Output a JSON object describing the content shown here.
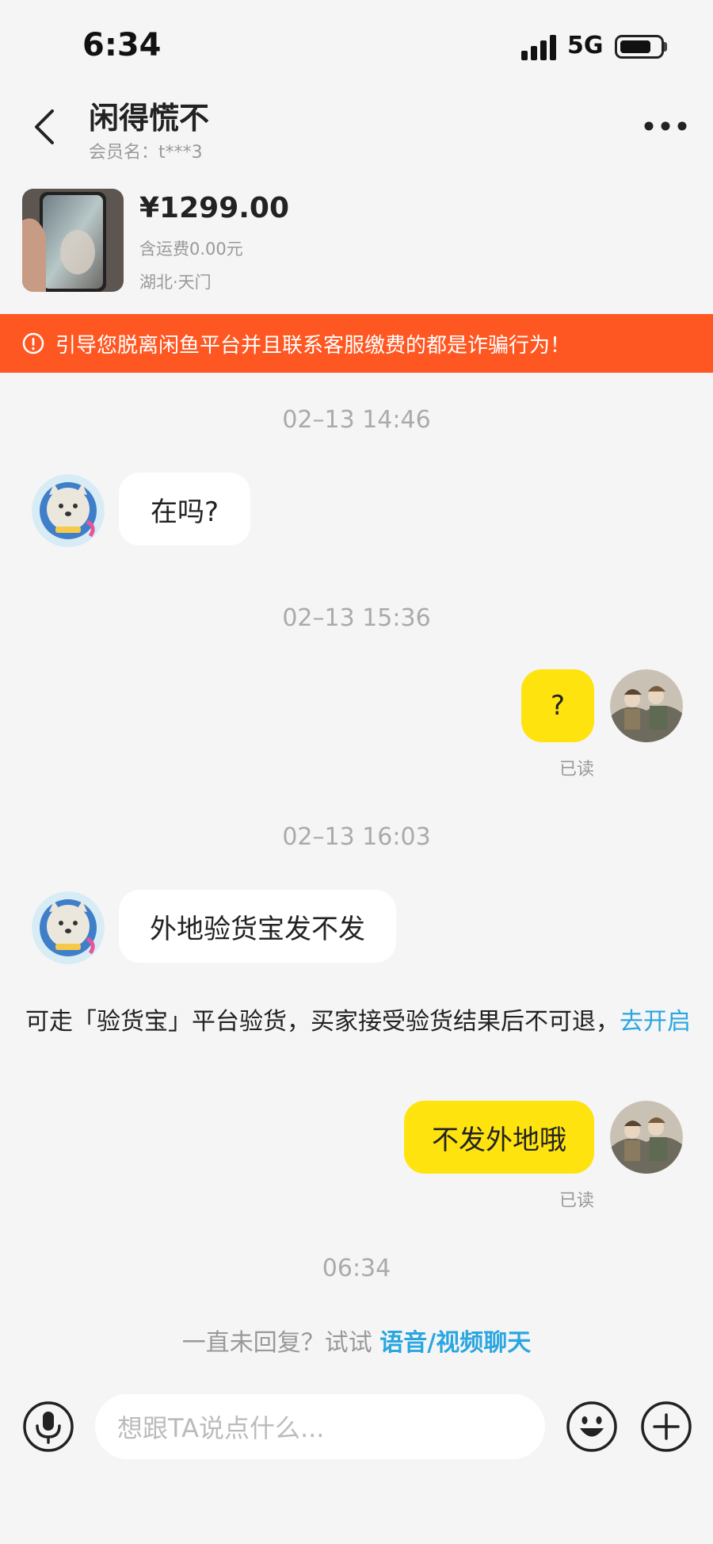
{
  "status": {
    "time": "6:34",
    "network": "5G"
  },
  "header": {
    "title": "闲得慌不",
    "member": "会员名：t***3"
  },
  "item": {
    "price": "¥1299.00",
    "shipping": "含运费0.00元",
    "location": "湖北·天门"
  },
  "warning": "引导您脱离闲鱼平台并且联系客服缴费的都是诈骗行为！",
  "messages": {
    "ts1": "02–13 14:46",
    "m1": "在吗?",
    "ts2": "02–13 15:36",
    "m2": "?",
    "m2_status": "已读",
    "ts3": "02–13 16:03",
    "m3": "外地验货宝发不发",
    "system_text": "可走「验货宝」平台验货，买家接受验货结果后不可退，",
    "system_link": "去开启",
    "m4": "不发外地哦",
    "m4_status": "已读",
    "ts4": "06:34"
  },
  "hint": {
    "text": "一直未回复？试试 ",
    "link": "语音/视频聊天"
  },
  "input": {
    "placeholder": "想跟TA说点什么..."
  },
  "colors": {
    "accent": "#ff5722",
    "bubble_out": "#ffe30f",
    "link": "#2aa6e0"
  }
}
